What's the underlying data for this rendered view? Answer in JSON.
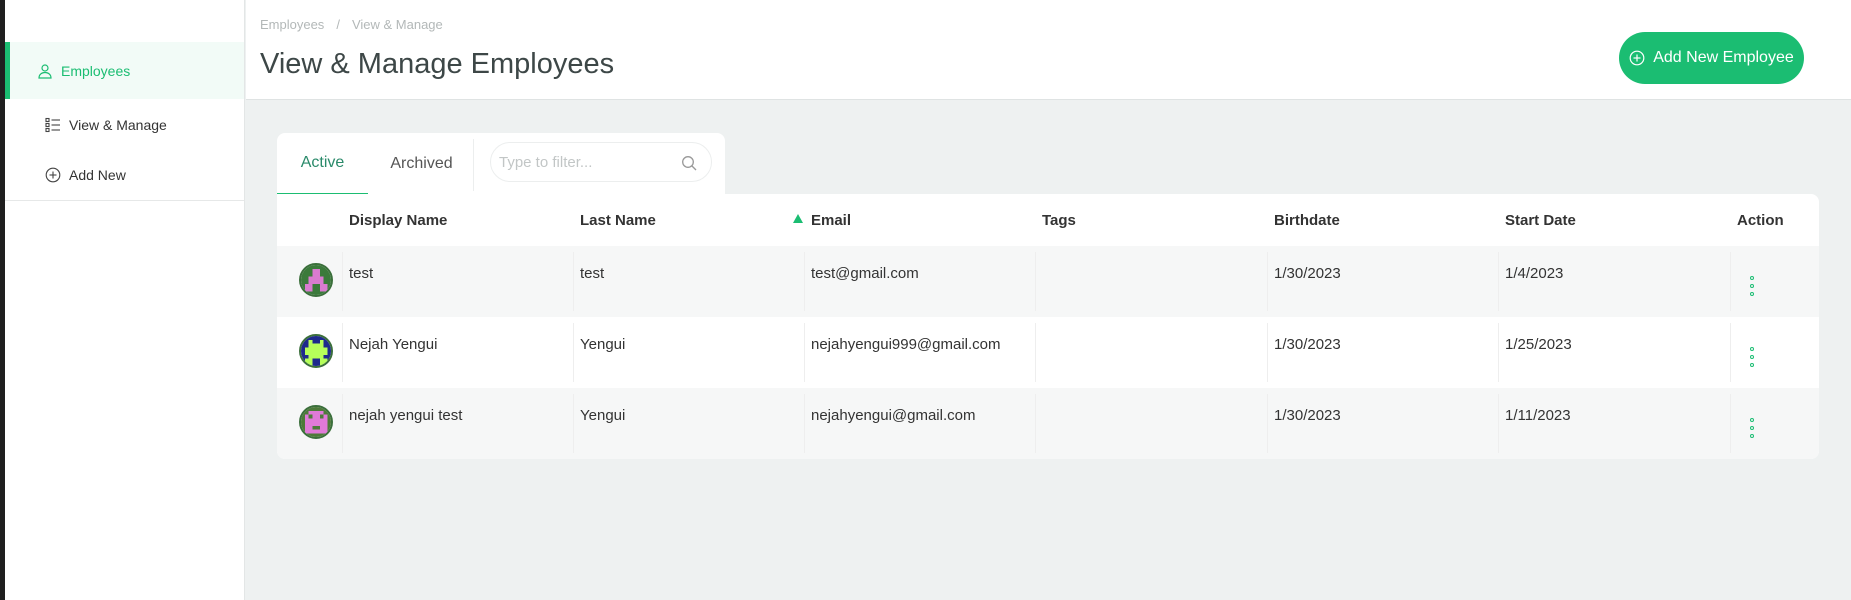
{
  "sidebar": {
    "items": [
      {
        "label": "Employees"
      },
      {
        "label": "View & Manage"
      },
      {
        "label": "Add New"
      }
    ]
  },
  "header": {
    "breadcrumb": [
      "Employees",
      "/",
      "View & Manage"
    ],
    "title": "View & Manage Employees",
    "add_button_label": "Add New Employee"
  },
  "tabs": [
    {
      "label": "Active",
      "selected": true
    },
    {
      "label": "Archived",
      "selected": false
    }
  ],
  "filter": {
    "placeholder": "Type to filter..."
  },
  "table": {
    "columns": [
      "Display Name",
      "Last Name",
      "Email",
      "Tags",
      "Birthdate",
      "Start Date",
      "Action"
    ],
    "sorted_column": "Email",
    "rows": [
      {
        "display_name": "test",
        "last_name": "test",
        "email": "test@gmail.com",
        "tags": "",
        "birthdate": "1/30/2023",
        "start_date": "1/4/2023"
      },
      {
        "display_name": "Nejah Yengui",
        "last_name": "Yengui",
        "email": "nejahyengui999@gmail.com",
        "tags": "",
        "birthdate": "1/30/2023",
        "start_date": "1/25/2023"
      },
      {
        "display_name": "nejah yengui test",
        "last_name": "Yengui",
        "email": "nejahyengui@gmail.com",
        "tags": "",
        "birthdate": "1/30/2023",
        "start_date": "1/11/2023"
      }
    ]
  },
  "colors": {
    "accent": "#1bbd72",
    "background": "#eef1f1"
  }
}
